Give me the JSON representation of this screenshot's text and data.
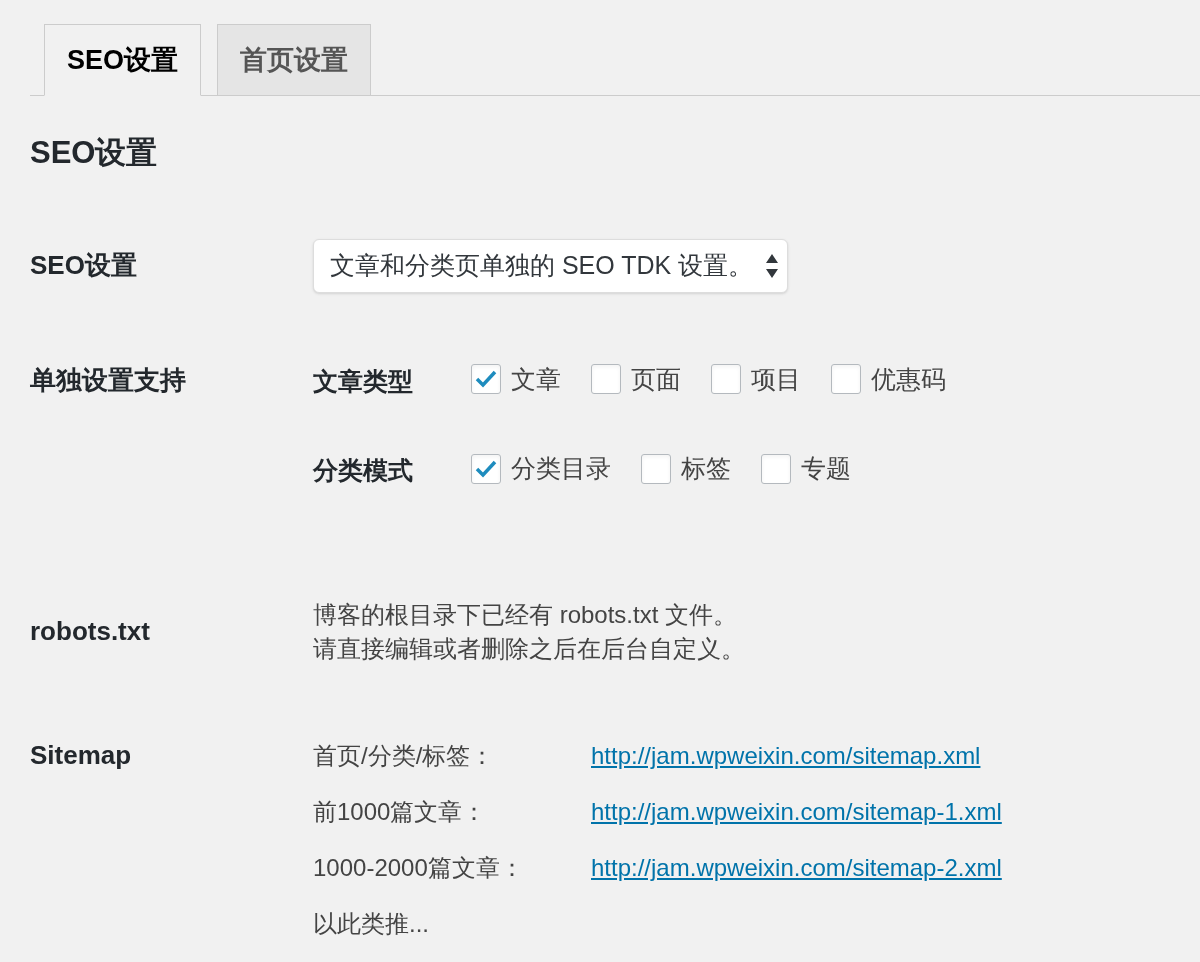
{
  "tabs": [
    {
      "label": "SEO设置",
      "selected": true
    },
    {
      "label": "首页设置",
      "selected": false
    }
  ],
  "heading": "SEO设置",
  "fields": [
    {
      "kind": "select",
      "label": "SEO设置",
      "value": "文章和分类页单独的 SEO TDK 设置。"
    },
    {
      "kind": "checkgroups",
      "label": "单独设置支持",
      "groups": [
        {
          "label": "文章类型",
          "options": [
            {
              "label": "文章",
              "checked": true
            },
            {
              "label": "页面",
              "checked": false
            },
            {
              "label": "项目",
              "checked": false
            },
            {
              "label": "优惠码",
              "checked": false
            }
          ]
        },
        {
          "label": "分类模式",
          "options": [
            {
              "label": "分类目录",
              "checked": true
            },
            {
              "label": "标签",
              "checked": false
            },
            {
              "label": "专题",
              "checked": false
            }
          ]
        }
      ]
    },
    {
      "kind": "text",
      "label": "robots.txt",
      "lines": [
        "博客的根目录下已经有 robots.txt 文件。",
        "请直接编辑或者删除之后在后台自定义。"
      ]
    },
    {
      "kind": "links",
      "label": "Sitemap",
      "rows": [
        {
          "label": "首页/分类/标签：",
          "url": "http://jam.wpweixin.com/sitemap.xml"
        },
        {
          "label": "前1000篇文章：",
          "url": "http://jam.wpweixin.com/sitemap-1.xml"
        },
        {
          "label": "1000-2000篇文章：",
          "url": "http://jam.wpweixin.com/sitemap-2.xml"
        },
        {
          "label": "以此类推..."
        }
      ]
    }
  ]
}
